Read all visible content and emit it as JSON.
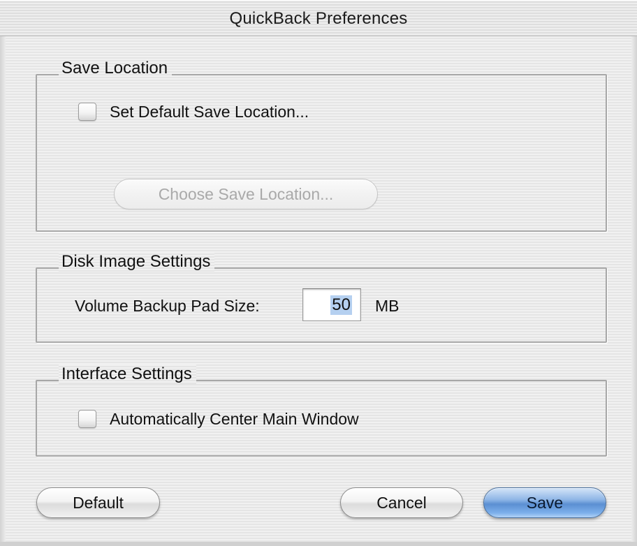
{
  "window": {
    "title": "QuickBack Preferences"
  },
  "save_location": {
    "group_title": "Save Location",
    "checkbox_label": "Set Default Save Location...",
    "checkbox_checked": false,
    "choose_button": "Choose Save Location..."
  },
  "disk_image": {
    "group_title": "Disk Image Settings",
    "pad_label": "Volume Backup Pad Size:",
    "pad_value": "50",
    "pad_unit": "MB"
  },
  "interface": {
    "group_title": "Interface Settings",
    "checkbox_label": "Automatically Center Main Window",
    "checkbox_checked": false
  },
  "buttons": {
    "default": "Default",
    "cancel": "Cancel",
    "save": "Save"
  },
  "colors": {
    "primary_button": "#5b8fd2",
    "groupbox_border": "#a7a7a7"
  }
}
